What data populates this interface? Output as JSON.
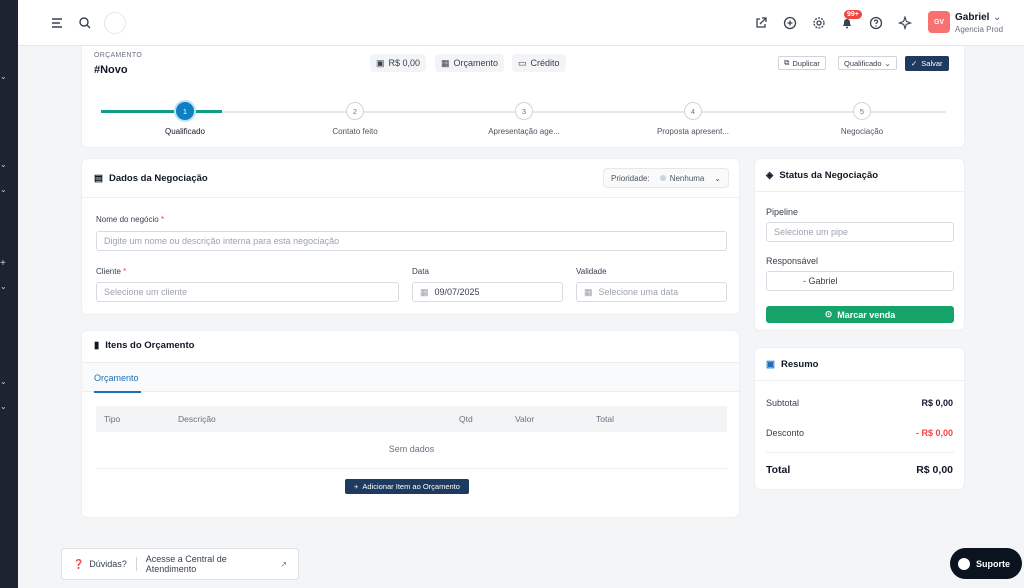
{
  "topbar": {
    "user_name": "Gabriel",
    "user_org": "Agencia Prod",
    "avatar_initials": "GV",
    "notification_count": "99+"
  },
  "header": {
    "section_label": "ORÇAMENTO",
    "title": "#Novo",
    "pills": [
      "R$ 0,00",
      "Orçamento",
      "Crédito"
    ],
    "duplicate_label": "Duplicar",
    "status_select": "Qualificado",
    "save_label": "Salvar"
  },
  "steps": [
    {
      "num": "1",
      "label": "Qualificado"
    },
    {
      "num": "2",
      "label": "Contato feito"
    },
    {
      "num": "3",
      "label": "Apresentação age..."
    },
    {
      "num": "4",
      "label": "Proposta apresent..."
    },
    {
      "num": "5",
      "label": "Negociação"
    }
  ],
  "dados": {
    "title": "Dados da Negociação",
    "priority_label": "Prioridade:",
    "priority_value": "Nenhuma",
    "nome_label": "Nome do negócio",
    "nome_placeholder": "Digite um nome ou descrição interna para esta negociação",
    "cliente_label": "Cliente",
    "cliente_placeholder": "Selecione um cliente",
    "data_label": "Data",
    "data_value": "09/07/2025",
    "validade_label": "Validade",
    "validade_placeholder": "Selecione uma data",
    "required_mark": "*"
  },
  "itens": {
    "title": "Itens do Orçamento",
    "tab": "Orçamento",
    "columns": [
      "Tipo",
      "Descrição",
      "Qtd",
      "Valor",
      "Total"
    ],
    "empty_text": "Sem dados",
    "add_label": "Adicionar Item ao Orçamento"
  },
  "status": {
    "title": "Status da Negociação",
    "pipeline_label": "Pipeline",
    "pipeline_placeholder": "Selecione um pipe",
    "responsavel_label": "Responsável",
    "responsavel_value": "- Gabriel",
    "marcar_label": "Marcar venda"
  },
  "resumo": {
    "title": "Resumo",
    "subtotal_label": "Subtotal",
    "subtotal_value": "R$ 0,00",
    "desconto_label": "Desconto",
    "desconto_value": "- R$ 0,00",
    "total_label": "Total",
    "total_value": "R$ 0,00"
  },
  "footer": {
    "help_question": "Dúvidas?",
    "help_link": "Acesse a Central de Atendimento",
    "support_label": "Suporte"
  },
  "colors": {
    "primary": "#1e3a5f",
    "accent_blue": "#0f7fc4",
    "success": "#16a36a",
    "danger": "#ef4444"
  }
}
